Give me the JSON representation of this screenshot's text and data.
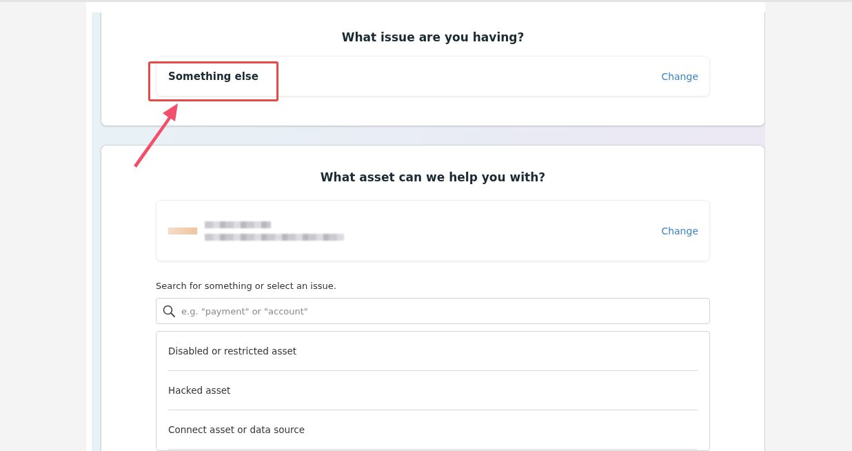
{
  "issue_section": {
    "heading": "What issue are you having?",
    "selection": {
      "label": "Something else",
      "action": "Change"
    }
  },
  "asset_section": {
    "heading": "What asset can we help you with?",
    "asset": {
      "action": "Change"
    },
    "search": {
      "label": "Search for something or select an issue.",
      "placeholder": "e.g. \"payment\" or \"account\""
    },
    "issues": [
      {
        "label": "Disabled or restricted asset"
      },
      {
        "label": "Hacked asset"
      },
      {
        "label": "Connect asset or data source"
      }
    ]
  }
}
